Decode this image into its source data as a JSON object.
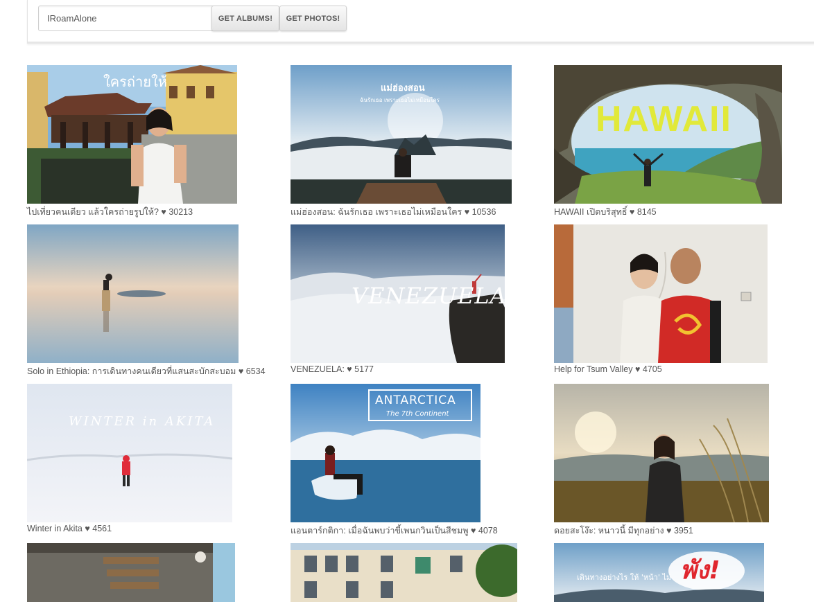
{
  "search": {
    "value": "IRoamAlone"
  },
  "buttons": {
    "albums": "GET ALBUMS!",
    "photos": "GET PHOTOS!"
  },
  "albums": [
    {
      "caption": "ไปเที่ยวคนเดียว แล้วใครถ่ายรูปให้? ♥ 30213",
      "overlay": "ใครถ่ายให้"
    },
    {
      "caption": "แม่ฮ่องสอน: ฉันรักเธอ เพราะเธอไม่เหมือนใคร ♥ 10536",
      "overlay": "แม่ฮ่องสอน",
      "overlay_sub": "ฉันรักเธอ เพราะเธอไม่เหมือนใคร"
    },
    {
      "caption": "HAWAII เปิดบริสุทธิ์ ♥ 8145",
      "overlay": "HAWAII"
    },
    {
      "caption": "Solo in Ethiopia: การเดินทางคนเดียวที่แสนสะบักสะบอม ♥ 6534"
    },
    {
      "caption": "VENEZUELA: ♥ 5177",
      "overlay": "VENEZUELA"
    },
    {
      "caption": "Help for Tsum Valley ♥ 4705"
    },
    {
      "caption": "Winter in Akita ♥ 4561",
      "overlay": "WINTER in AKITA"
    },
    {
      "caption": "แอนตาร์กติกา: เมื่อฉันพบว่าขี้เพนกวินเป็นสีชมพู ♥ 4078",
      "overlay": "ANTARCTICA",
      "overlay_sub": "The 7th Continent"
    },
    {
      "caption": "ดอยสะโง๊ะ: หนาวนี้ มีทุกอย่าง ♥ 3951"
    },
    {
      "caption": ""
    },
    {
      "caption": ""
    },
    {
      "caption": "",
      "overlay": "พัง!",
      "overlay_sub": "เดินทางอย่างไร ให้ 'หน้า' ไม่"
    }
  ]
}
